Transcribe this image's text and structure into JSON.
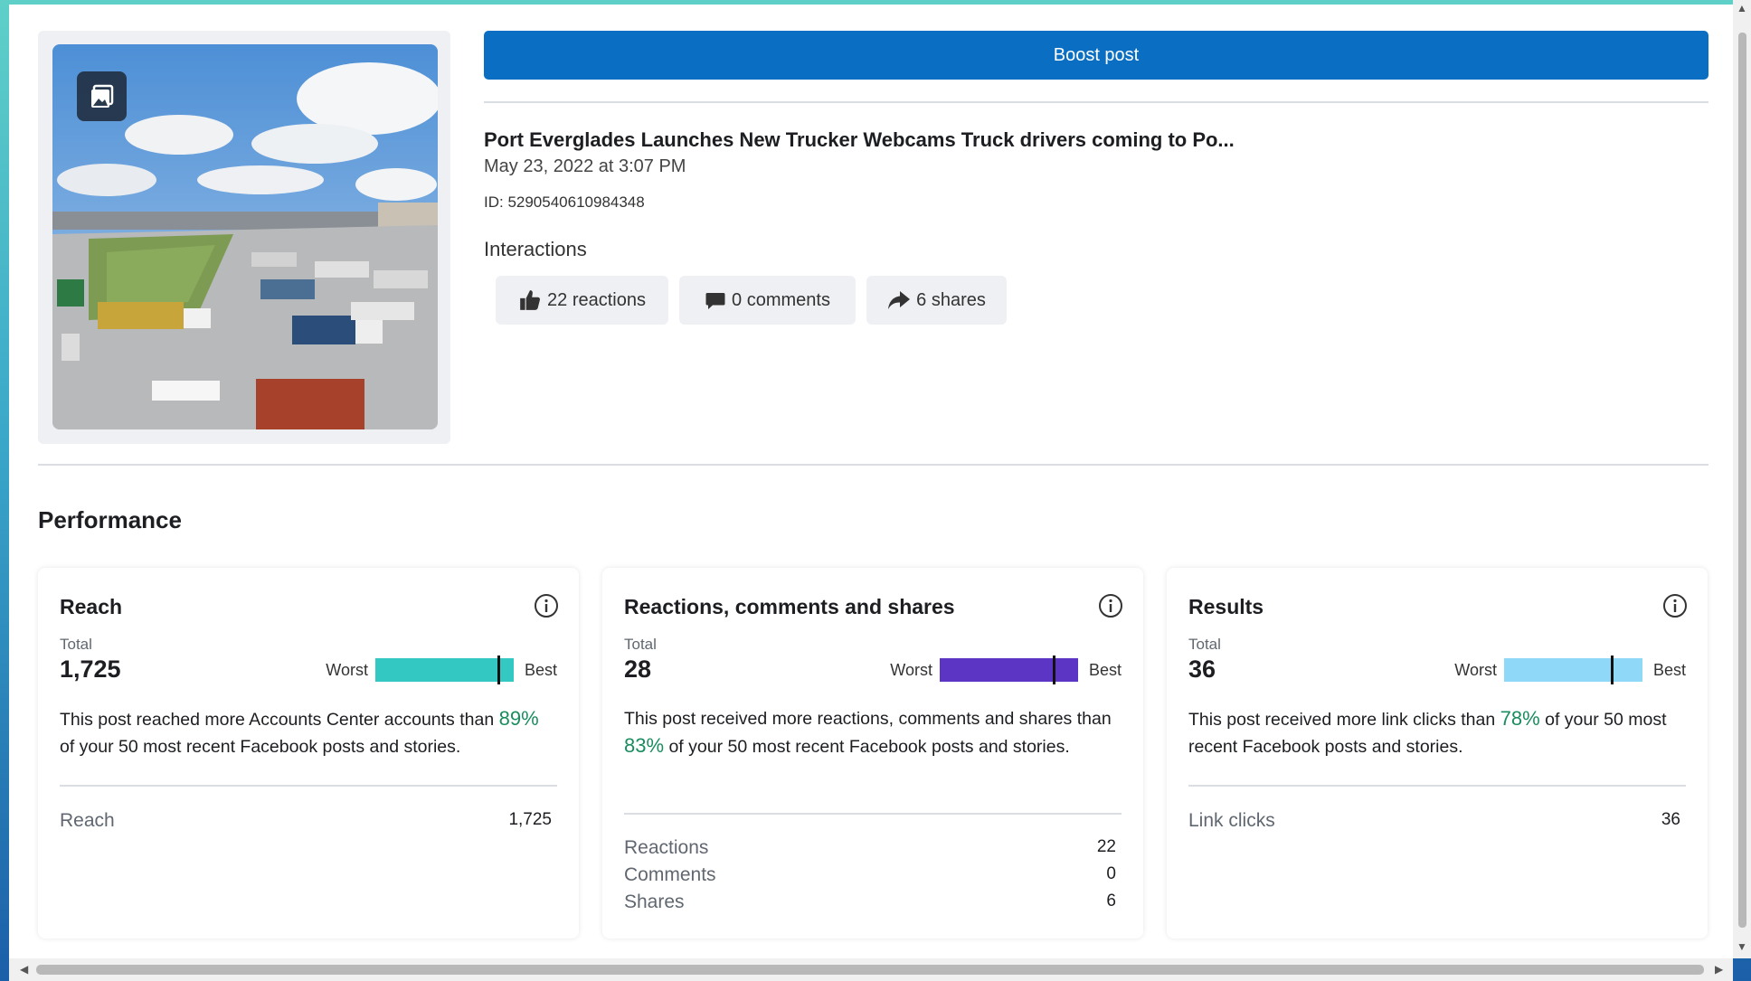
{
  "post": {
    "boost_label": "Boost post",
    "title": "Port Everglades Launches New Trucker Webcams Truck drivers coming to Po...",
    "date": "May 23, 2022 at 3:07 PM",
    "id": "ID: 5290540610984348",
    "media_icon": "image-icon"
  },
  "interactions": {
    "heading": "Interactions",
    "reactions": "22 reactions",
    "comments": "0 comments",
    "shares": "6 shares"
  },
  "performance": {
    "heading": "Performance",
    "total_label": "Total",
    "worst_label": "Worst",
    "best_label": "Best",
    "cards": [
      {
        "title": "Reach",
        "total": "1,725",
        "color": "#33c9c2",
        "marker_fraction": 0.89,
        "desc_before": "This post reached more Accounts Center accounts than ",
        "pct": "89%",
        "desc_after": " of your 50 most recent Facebook posts and stories.",
        "metrics": [
          {
            "name": "Reach",
            "value": "1,725"
          }
        ]
      },
      {
        "title": "Reactions, comments and shares",
        "total": "28",
        "color": "#5c35c4",
        "marker_fraction": 0.83,
        "desc_before": "This post received more reactions, comments and shares than ",
        "pct": "83%",
        "desc_after": " of your 50 most recent Facebook posts and stories.",
        "metrics": [
          {
            "name": "Reactions",
            "value": "22"
          },
          {
            "name": "Comments",
            "value": "0"
          },
          {
            "name": "Shares",
            "value": "6"
          }
        ]
      },
      {
        "title": "Results",
        "total": "36",
        "color": "#8fd8f7",
        "marker_fraction": 0.78,
        "desc_before": "This post received more link clicks than ",
        "pct": "78%",
        "desc_after": " of your 50 most recent Facebook posts and stories.",
        "metrics": [
          {
            "name": "Link clicks",
            "value": "36"
          }
        ]
      }
    ]
  }
}
